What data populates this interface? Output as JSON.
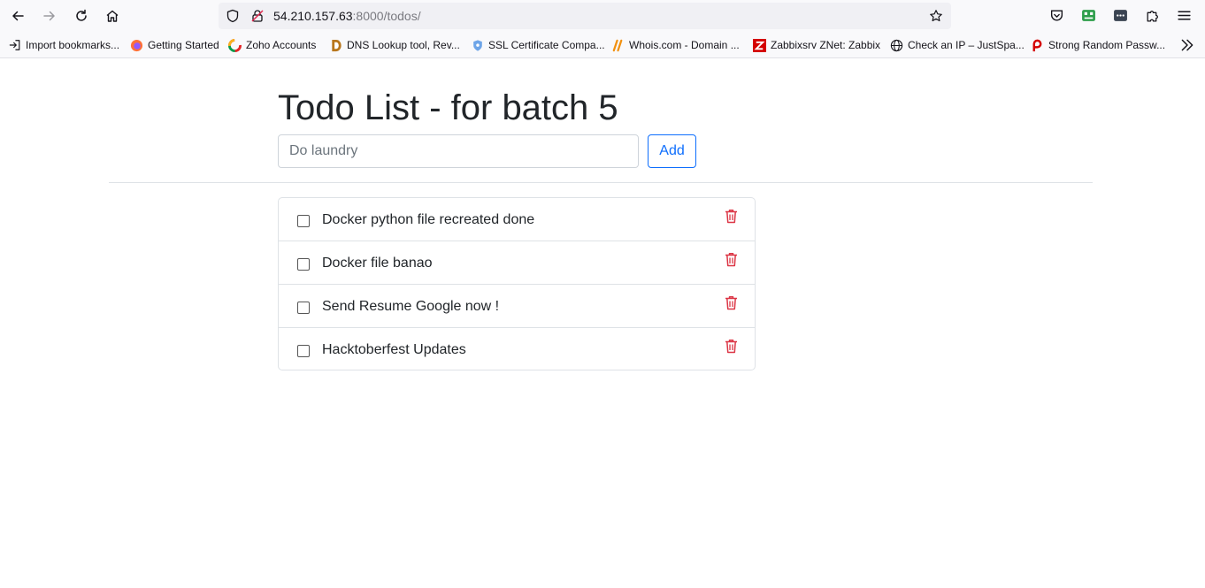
{
  "browser": {
    "url_host": "54.210.157.63",
    "url_rest": ":8000/todos/",
    "bookmarks": [
      {
        "label": "Import bookmarks...",
        "icon": "import-icon"
      },
      {
        "label": "Getting Started",
        "icon": "firefox-icon"
      },
      {
        "label": "Zoho Accounts",
        "icon": "zoho-icon"
      },
      {
        "label": "DNS Lookup tool, Rev...",
        "icon": "dns-icon"
      },
      {
        "label": "SSL Certificate Compa...",
        "icon": "shield-icon"
      },
      {
        "label": "Whois.com - Domain ...",
        "icon": "whois-icon"
      },
      {
        "label": "Zabbixsrv ZNet: Zabbix",
        "icon": "zabbix-icon"
      },
      {
        "label": "Check an IP – JustSpa...",
        "icon": "globe-icon"
      },
      {
        "label": "Strong Random Passw...",
        "icon": "password-icon"
      }
    ]
  },
  "page": {
    "title": "Todo List - for batch 5",
    "input_placeholder": "Do laundry",
    "add_label": "Add"
  },
  "todos": [
    {
      "text": "Docker python file recreated done",
      "done": false
    },
    {
      "text": "Docker file banao",
      "done": false
    },
    {
      "text": "Send Resume Google now !",
      "done": false
    },
    {
      "text": "Hacktoberfest Updates",
      "done": false
    }
  ],
  "colors": {
    "accent": "#0d6efd",
    "delete": "#dc3545"
  }
}
